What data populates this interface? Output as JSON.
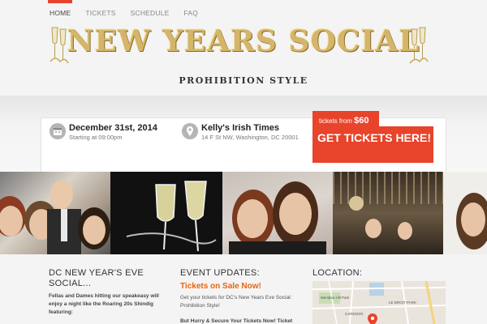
{
  "nav": {
    "items": [
      {
        "label": "HOME",
        "active": true
      },
      {
        "label": "TICKETS",
        "active": false
      },
      {
        "label": "SCHEDULE",
        "active": false
      },
      {
        "label": "FAQ",
        "active": false
      }
    ]
  },
  "banner": {
    "title": "NEW YEARS SOCIAL",
    "subtitle": "PROHIBITION STYLE"
  },
  "event": {
    "date": "December 31st, 2014",
    "time": "Starting at 09:00pm",
    "venue": "Kelly's Irish Times",
    "address": "14 F St NW, Washington, DC 20001"
  },
  "tickets": {
    "from_label": "tickets from",
    "price": "$60",
    "cta": "GET TICKETS HERE!"
  },
  "columns": {
    "about": {
      "title": "DC NEW YEAR'S EVE SOCIAL...",
      "text": "Fellas and Dames hitting our speakeasy will enjoy a night like the Roaring 20s Shindig featuring:"
    },
    "updates": {
      "title": "EVENT UPDATES:",
      "headline": "Tickets on Sale Now!",
      "text": "Get your tickets for DC's New Years Eve Social: Prohibition Style!",
      "text2": "But Hurry & Secure Your Tickets Now! Ticket"
    },
    "location": {
      "title": "LOCATION:",
      "map_labels": [
        "Meridian Hill Park",
        "CARDOZO",
        "LE DROIT PARK"
      ]
    }
  },
  "colors": {
    "accent": "#e8432b",
    "orange": "#e8640d",
    "gold": "#d4b56a"
  }
}
